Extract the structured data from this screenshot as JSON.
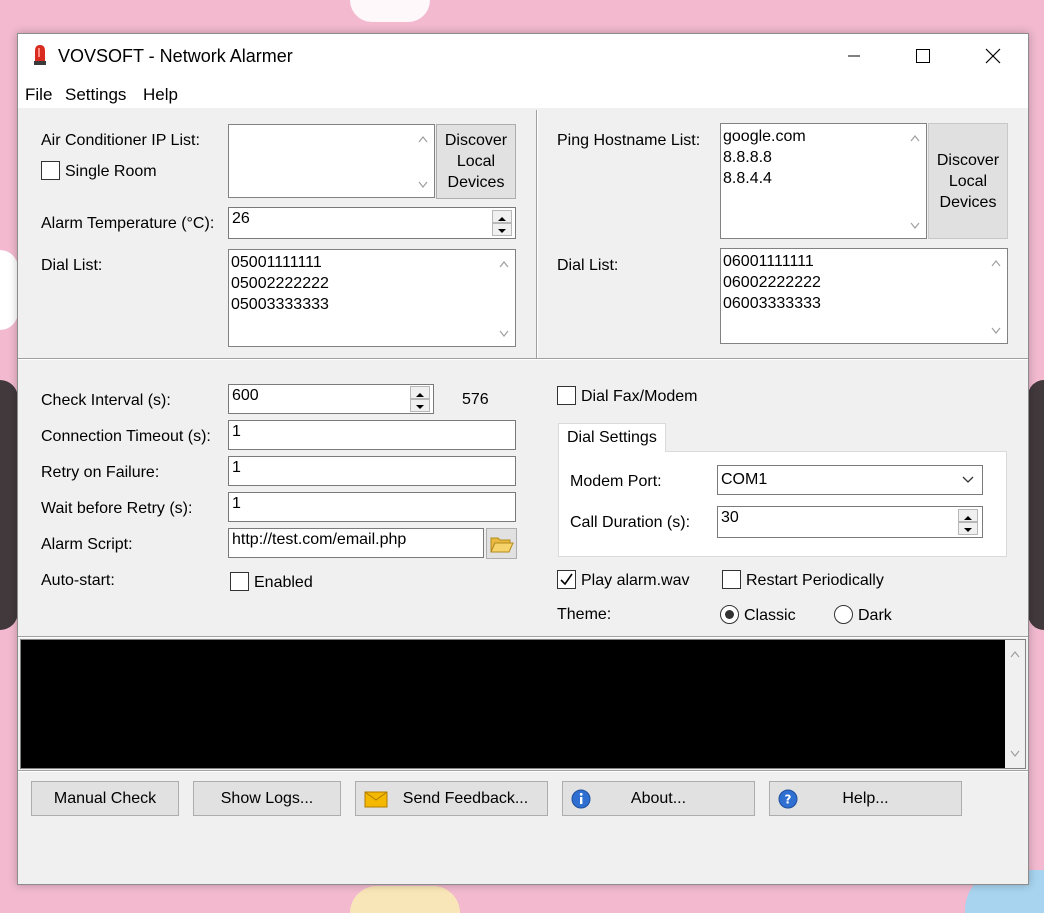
{
  "window": {
    "title": "VOVSOFT - Network Alarmer"
  },
  "menu": {
    "file": "File",
    "settings": "Settings",
    "help": "Help"
  },
  "ac": {
    "ip_list_label": "Air Conditioner IP List:",
    "single_room_label": "Single Room",
    "single_room_checked": false,
    "discover_button": [
      "Discover",
      "Local",
      "Devices"
    ],
    "alarm_temp_label": "Alarm Temperature (°C):",
    "alarm_temp_value": "26",
    "dial_list_label": "Dial List:",
    "dial_list": [
      "05001111111",
      "05002222222",
      "05003333333"
    ]
  },
  "ping": {
    "hostname_list_label": "Ping Hostname List:",
    "hostnames": [
      "google.com",
      "8.8.8.8",
      "8.8.4.4"
    ],
    "discover_button": [
      "Discover",
      "Local",
      "Devices"
    ],
    "dial_list_label": "Dial List:",
    "dial_list": [
      "06001111111",
      "06002222222",
      "06003333333"
    ]
  },
  "options": {
    "check_interval_label": "Check Interval (s):",
    "check_interval_value": "600",
    "countdown": "576",
    "timeout_label": "Connection Timeout (s):",
    "timeout_value": "1",
    "retry_label": "Retry on Failure:",
    "retry_value": "1",
    "wait_label": "Wait before Retry (s):",
    "wait_value": "1",
    "script_label": "Alarm Script:",
    "script_value": "http://test.com/email.php",
    "autostart_label": "Auto-start:",
    "enabled_label": "Enabled",
    "enabled_checked": false
  },
  "dial": {
    "fax_modem_label": "Dial Fax/Modem",
    "fax_modem_checked": false,
    "tab_label": "Dial Settings",
    "modem_port_label": "Modem Port:",
    "modem_port_value": "COM1",
    "call_duration_label": "Call Duration (s):",
    "call_duration_value": "30",
    "play_alarm_label": "Play alarm.wav",
    "play_alarm_checked": true,
    "restart_label": "Restart Periodically",
    "restart_checked": false,
    "theme_label": "Theme:",
    "theme_classic": "Classic",
    "theme_dark": "Dark",
    "theme_selected": "Classic"
  },
  "buttons": {
    "manual_check": "Manual Check",
    "show_logs": "Show Logs...",
    "send_feedback": "Send Feedback...",
    "about": "About...",
    "help": "Help..."
  },
  "colors": {
    "accent_red": "#d92b20",
    "info_blue": "#2f6fd1",
    "mail_yellow": "#f5b800"
  }
}
